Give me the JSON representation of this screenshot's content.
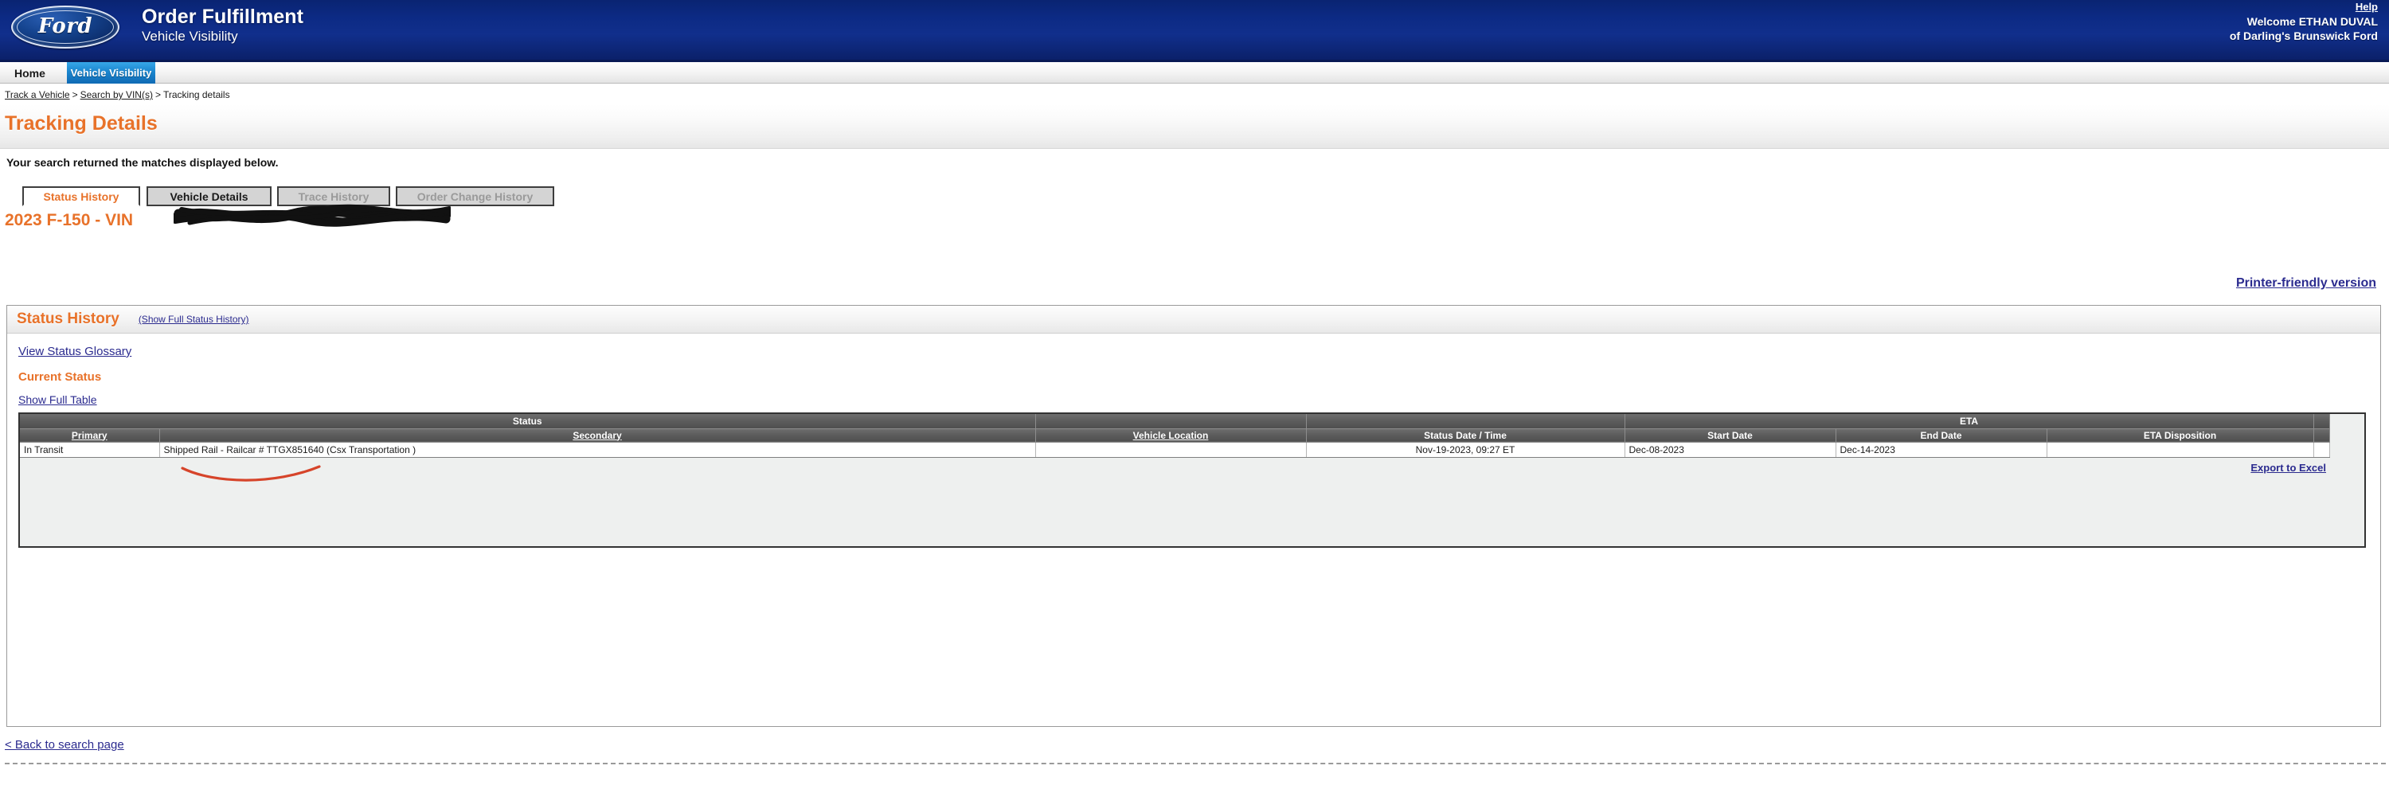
{
  "header": {
    "brand": "Ford",
    "app_title": "Order Fulfillment",
    "app_subtitle": "Vehicle Visibility",
    "help_label": "Help",
    "welcome_line1": "Welcome ETHAN DUVAL",
    "welcome_line2": "of Darling's Brunswick Ford",
    "brand_blue": "#0c2a84",
    "accent_orange": "#e8722a",
    "link_blue": "#2b2b8f"
  },
  "nav": {
    "home_label": "Home",
    "active_tab_label": "Vehicle Visibility"
  },
  "breadcrumb": {
    "items": [
      {
        "label": "Track a Vehicle",
        "link": true
      },
      {
        "label": "Search by VIN(s)",
        "link": true
      },
      {
        "label": "Tracking details",
        "link": false
      }
    ],
    "separator": ">"
  },
  "page": {
    "title": "Tracking Details",
    "subtitle": "Your search returned the matches displayed below.",
    "printer_link": "Printer-friendly version",
    "back_link": "< Back to search page"
  },
  "tabs": [
    {
      "label": "Status History",
      "state": "active"
    },
    {
      "label": "Vehicle Details",
      "state": "normal"
    },
    {
      "label": "Trace History",
      "state": "disabled"
    },
    {
      "label": "Order Change History",
      "state": "disabled"
    }
  ],
  "vehicle": {
    "heading": "2023 F-150 - VIN",
    "vin_redacted": true
  },
  "panel": {
    "title": "Status History",
    "show_full_link": "(Show Full Status History)",
    "glossary_link": "View Status Glossary",
    "current_status_label": "Current Status",
    "show_full_table_link": "Show Full Table",
    "export_link": "Export to Excel"
  },
  "table": {
    "group_headers": [
      {
        "label": "Status",
        "span": 2
      },
      {
        "label": "",
        "span": 1
      },
      {
        "label": "",
        "span": 1
      },
      {
        "label": "ETA",
        "span": 3
      },
      {
        "label": "",
        "span": 1
      }
    ],
    "columns": [
      {
        "label": "Primary",
        "sortable": true
      },
      {
        "label": "Secondary",
        "sortable": true
      },
      {
        "label": "Vehicle Location",
        "sortable": true
      },
      {
        "label": "Status Date / Time",
        "sortable": false
      },
      {
        "label": "Start Date",
        "sortable": false
      },
      {
        "label": "End Date",
        "sortable": false
      },
      {
        "label": "ETA Disposition",
        "sortable": false
      },
      {
        "label": "",
        "sortable": false
      }
    ],
    "rows": [
      {
        "primary": "In Transit",
        "secondary": "Shipped Rail - Railcar # TTGX851640 (Csx Transportation )",
        "vehicle_location": "",
        "status_date_time": "Nov-19-2023, 09:27 ET",
        "eta_start_date": "Dec-08-2023",
        "eta_end_date": "Dec-14-2023",
        "eta_disposition": "",
        "spacer": ""
      }
    ]
  },
  "annotations": {
    "underline_color": "#d6442a",
    "redaction_color": "#111111"
  }
}
